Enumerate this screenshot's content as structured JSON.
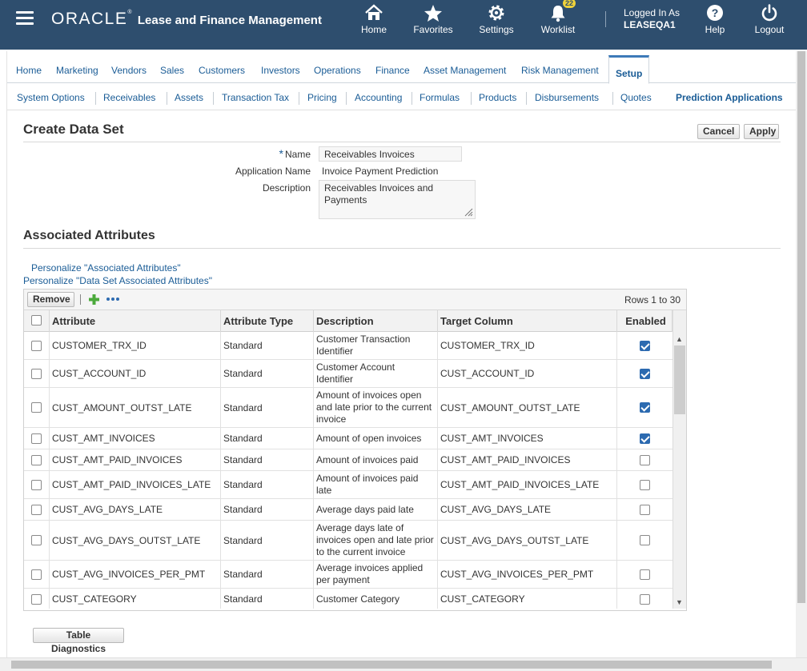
{
  "header": {
    "brand": "ORACLE",
    "product": "Lease and Finance Management",
    "nav": [
      {
        "label": "Home",
        "icon": "home-icon"
      },
      {
        "label": "Favorites",
        "icon": "star-icon"
      },
      {
        "label": "Settings",
        "icon": "gear-icon"
      },
      {
        "label": "Worklist",
        "icon": "bell-icon",
        "badge": "22"
      },
      {
        "label": "Help",
        "icon": "help-icon"
      },
      {
        "label": "Logout",
        "icon": "power-icon"
      }
    ],
    "logged_in_label": "Logged In As",
    "user": "LEASEQA1"
  },
  "tabs": [
    "Home",
    "Marketing",
    "Vendors",
    "Sales",
    "Customers",
    "Investors",
    "Operations",
    "Finance",
    "Asset Management",
    "Risk Management",
    "Setup"
  ],
  "active_tab": "Setup",
  "subtabs": [
    "System Options",
    "Receivables",
    "Assets",
    "Transaction Tax",
    "Pricing",
    "Accounting",
    "Formulas",
    "Products",
    "Disbursements",
    "Quotes"
  ],
  "subtab_right": "Prediction Applications",
  "page": {
    "title": "Create Data Set",
    "cancel": "Cancel",
    "apply": "Apply",
    "required_marker": "*",
    "fields": {
      "name_label": "Name",
      "name_value": "Receivables Invoices",
      "app_label": "Application Name",
      "app_value": "Invoice Payment Prediction",
      "desc_label": "Description",
      "desc_value": "Receivables Invoices and Payments"
    },
    "section_title": "Associated Attributes",
    "personalize_1": "Personalize \"Associated Attributes\"",
    "personalize_2": "Personalize \"Data Set Associated Attributes\"",
    "remove": "Remove",
    "rows_info": "Rows 1 to 30",
    "table_diagnostics": "Table Diagnostics"
  },
  "table": {
    "columns": [
      "Attribute",
      "Attribute Type",
      "Description",
      "Target Column",
      "Enabled"
    ],
    "rows": [
      {
        "attribute": "CUSTOMER_TRX_ID",
        "type": "Standard",
        "description": "Customer Transaction Identifier",
        "target": "CUSTOMER_TRX_ID",
        "enabled": true
      },
      {
        "attribute": "CUST_ACCOUNT_ID",
        "type": "Standard",
        "description": "Customer Account Identifier",
        "target": "CUST_ACCOUNT_ID",
        "enabled": true
      },
      {
        "attribute": "CUST_AMOUNT_OUTST_LATE",
        "type": "Standard",
        "description": "Amount of invoices open and late prior to the current invoice",
        "target": "CUST_AMOUNT_OUTST_LATE",
        "enabled": true
      },
      {
        "attribute": "CUST_AMT_INVOICES",
        "type": "Standard",
        "description": "Amount of open invoices",
        "target": "CUST_AMT_INVOICES",
        "enabled": true
      },
      {
        "attribute": "CUST_AMT_PAID_INVOICES",
        "type": "Standard",
        "description": "Amount of invoices paid",
        "target": "CUST_AMT_PAID_INVOICES",
        "enabled": false
      },
      {
        "attribute": "CUST_AMT_PAID_INVOICES_LATE",
        "type": "Standard",
        "description": "Amount of invoices paid late",
        "target": "CUST_AMT_PAID_INVOICES_LATE",
        "enabled": false
      },
      {
        "attribute": "CUST_AVG_DAYS_LATE",
        "type": "Standard",
        "description": "Average days paid late",
        "target": "CUST_AVG_DAYS_LATE",
        "enabled": false
      },
      {
        "attribute": "CUST_AVG_DAYS_OUTST_LATE",
        "type": "Standard",
        "description": "Average days late of invoices open and late prior to the current invoice",
        "target": "CUST_AVG_DAYS_OUTST_LATE",
        "enabled": false
      },
      {
        "attribute": "CUST_AVG_INVOICES_PER_PMT",
        "type": "Standard",
        "description": "Average invoices applied per payment",
        "target": "CUST_AVG_INVOICES_PER_PMT",
        "enabled": false
      },
      {
        "attribute": "CUST_CATEGORY",
        "type": "Standard",
        "description": "Customer Category",
        "target": "CUST_CATEGORY",
        "enabled": false
      }
    ]
  }
}
